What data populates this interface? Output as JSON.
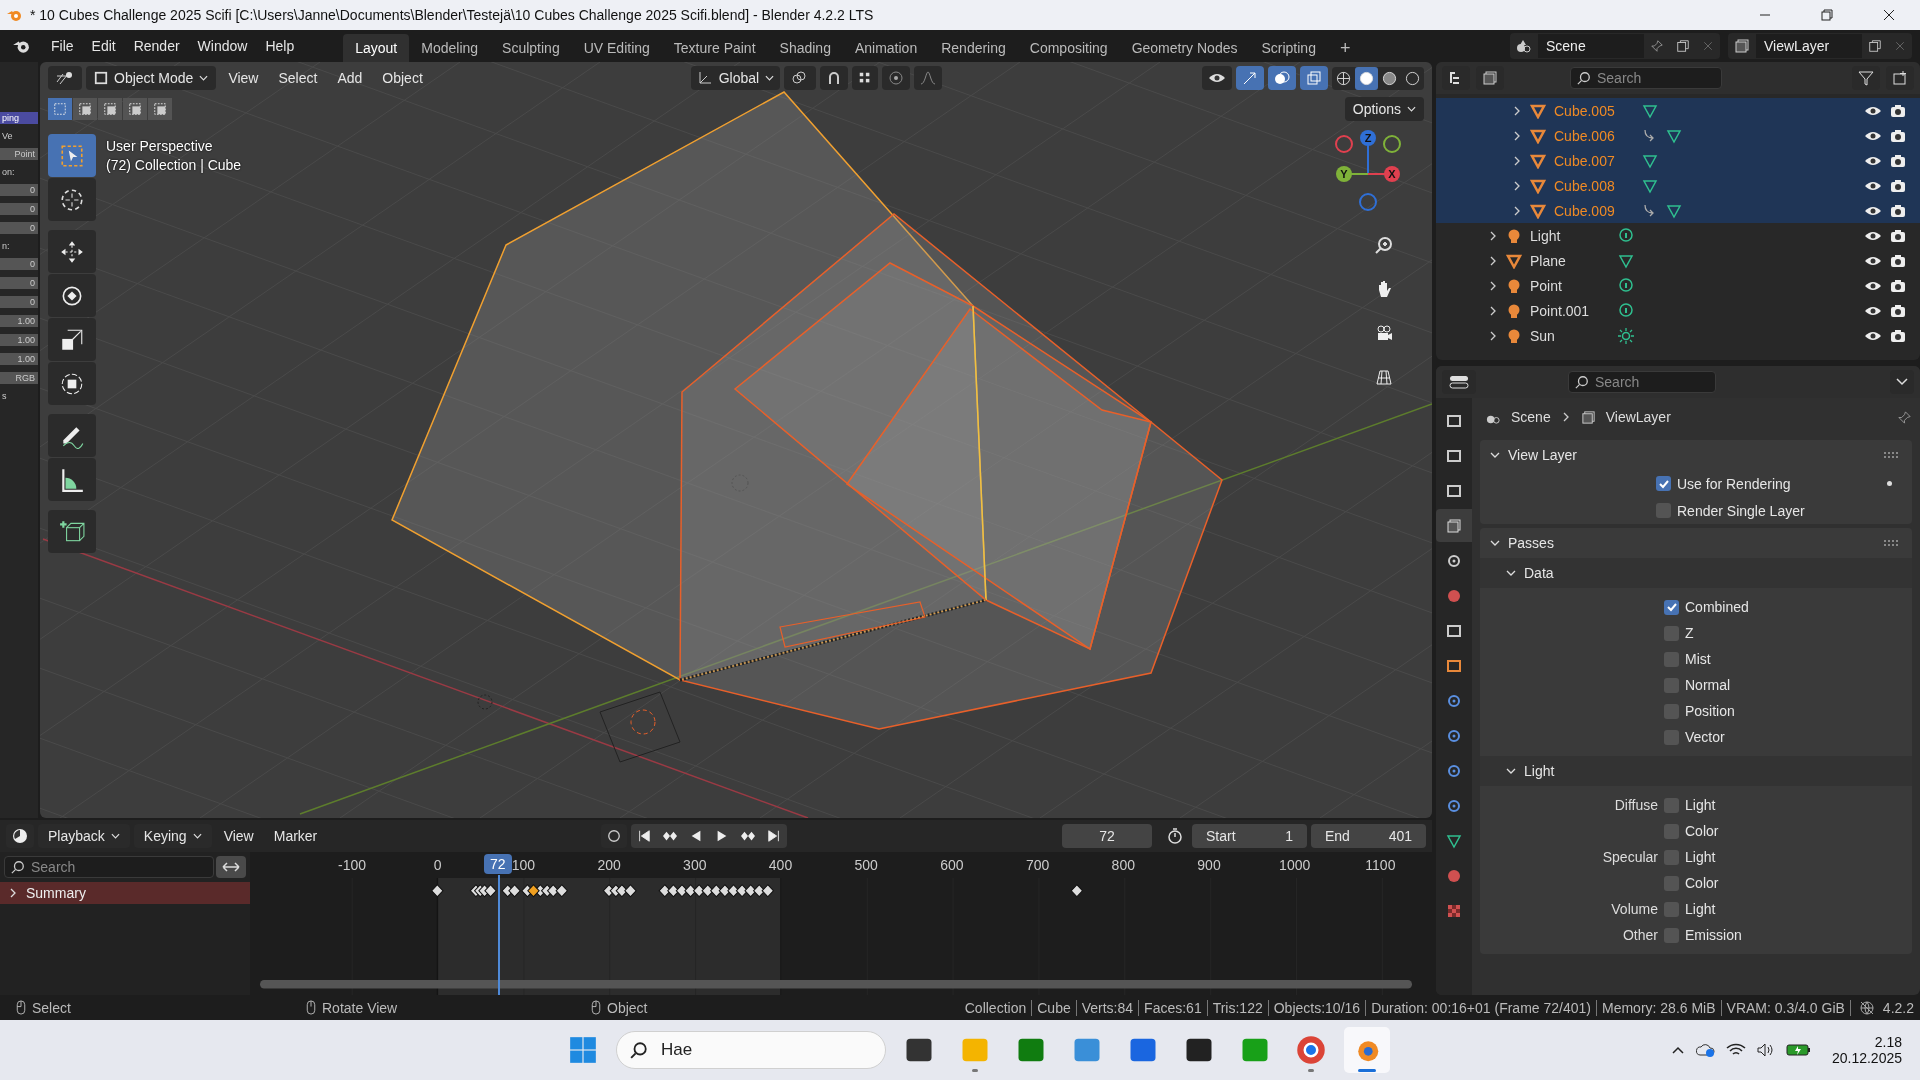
{
  "title_bar": {
    "title": "* 10 Cubes Challenge 2025 Scifi [C:\\Users\\Janne\\Documents\\Blender\\Testejä\\10 Cubes Challenge 2025 Scifi.blend] - Blender 4.2.2 LTS"
  },
  "menu": [
    "File",
    "Edit",
    "Render",
    "Window",
    "Help"
  ],
  "workspaces": [
    {
      "label": "Layout",
      "selected": true
    },
    {
      "label": "Modeling",
      "selected": false
    },
    {
      "label": "Sculpting",
      "selected": false
    },
    {
      "label": "UV Editing",
      "selected": false
    },
    {
      "label": "Texture Paint",
      "selected": false
    },
    {
      "label": "Shading",
      "selected": false
    },
    {
      "label": "Animation",
      "selected": false
    },
    {
      "label": "Rendering",
      "selected": false
    },
    {
      "label": "Compositing",
      "selected": false
    },
    {
      "label": "Geometry Nodes",
      "selected": false
    },
    {
      "label": "Scripting",
      "selected": false
    }
  ],
  "add_workspace": "+",
  "scene": {
    "name": "Scene"
  },
  "view_layer": {
    "name": "ViewLayer"
  },
  "left_panel": {
    "fragments": [
      {
        "kind": "header",
        "text": "ping"
      },
      {
        "kind": "label",
        "text": "Ve"
      },
      {
        "kind": "field",
        "text": "Point"
      },
      {
        "kind": "label",
        "text": "on:"
      },
      {
        "kind": "field",
        "text": "0"
      },
      {
        "kind": "field",
        "text": "0"
      },
      {
        "kind": "field",
        "text": "0"
      },
      {
        "kind": "label",
        "text": "n:"
      },
      {
        "kind": "field",
        "text": "0"
      },
      {
        "kind": "field",
        "text": "0"
      },
      {
        "kind": "field",
        "text": "0"
      },
      {
        "kind": "field",
        "text": "1.00"
      },
      {
        "kind": "field",
        "text": "1.00"
      },
      {
        "kind": "field",
        "text": "1.00"
      },
      {
        "kind": "field",
        "text": "RGB"
      },
      {
        "kind": "label",
        "text": "s"
      }
    ]
  },
  "viewport": {
    "mode": "Object Mode",
    "menus": [
      "View",
      "Select",
      "Add",
      "Object"
    ],
    "orientation": "Global",
    "options": "Options",
    "select_modes": [
      {
        "selected": true
      },
      {
        "selected": false
      },
      {
        "selected": false
      },
      {
        "selected": false
      },
      {
        "selected": false
      }
    ],
    "shading": [
      {
        "selected": false
      },
      {
        "selected": true
      },
      {
        "selected": false
      },
      {
        "selected": false
      }
    ],
    "tools": [
      {
        "selected": true
      },
      {
        "selected": false
      },
      {
        "selected": false
      },
      {
        "selected": false
      },
      {
        "selected": false
      },
      {
        "selected": false
      },
      {
        "selected": false
      },
      {
        "selected": false
      },
      {
        "selected": false
      }
    ],
    "overlay": [
      "User Perspective",
      "(72) Collection | Cube"
    ],
    "gizmo": [
      {
        "label": "Z",
        "color": "#2f6fd6"
      },
      {
        "label": "Y",
        "color": "#7fb239"
      },
      {
        "label": "X",
        "color": "#e0404f"
      }
    ]
  },
  "timeline": {
    "menus": [
      "Playback",
      "Keying",
      "View",
      "Marker"
    ],
    "current_frame": "72",
    "start_label": "Start",
    "start": "1",
    "end_label": "End",
    "end": "401",
    "search": {
      "placeholder": "Search"
    },
    "ruler": [
      "-100",
      "0",
      "100",
      "200",
      "300",
      "400",
      "500",
      "600",
      "700",
      "800",
      "900",
      "1000",
      "1100"
    ],
    "playhead": {
      "label": "72",
      "level": 0.212
    },
    "channels": [
      {
        "label": "Summary",
        "expanded": false
      }
    ]
  },
  "outliner": {
    "search": {
      "placeholder": "Search"
    },
    "nested_items": [
      {
        "name": "Cube.005",
        "selected": true,
        "modifier": false
      },
      {
        "name": "Cube.006",
        "selected": true,
        "modifier": true
      },
      {
        "name": "Cube.007",
        "selected": true,
        "modifier": false
      },
      {
        "name": "Cube.008",
        "selected": true,
        "modifier": false
      },
      {
        "name": "Cube.009",
        "selected": true,
        "modifier": true
      }
    ],
    "items": [
      {
        "name": "Light",
        "kind": "light",
        "selected": false
      },
      {
        "name": "Plane",
        "kind": "mesh",
        "selected": false
      },
      {
        "name": "Point",
        "kind": "light",
        "selected": false
      },
      {
        "name": "Point.001",
        "kind": "light",
        "selected": false
      },
      {
        "name": "Sun",
        "kind": "sun",
        "selected": false
      }
    ]
  },
  "properties": {
    "search": {
      "placeholder": "Search"
    },
    "tabs": [
      {
        "selected": false
      },
      {
        "selected": false
      },
      {
        "selected": false
      },
      {
        "selected": true
      },
      {
        "selected": false
      },
      {
        "selected": false
      },
      {
        "selected": false
      },
      {
        "selected": false
      },
      {
        "selected": false
      },
      {
        "selected": false
      },
      {
        "selected": false
      },
      {
        "selected": false
      },
      {
        "selected": false
      },
      {
        "selected": false
      },
      {
        "selected": false
      }
    ],
    "breadcrumb": [
      "Scene",
      "ViewLayer"
    ],
    "view_layer_panel": {
      "title": "View Layer",
      "expanded": true,
      "rows": [
        {
          "label": "Use for Rendering",
          "checked": true
        },
        {
          "label": "Render Single Layer",
          "checked": false
        }
      ]
    },
    "passes_panel": {
      "title": "Passes",
      "expanded": true,
      "subpanels": [
        {
          "title": "Data",
          "expanded": true,
          "rows": [
            {
              "label": "Combined",
              "checked": true
            },
            {
              "label": "Z",
              "checked": false
            },
            {
              "label": "Mist",
              "checked": false
            },
            {
              "label": "Normal",
              "checked": false
            },
            {
              "label": "Position",
              "checked": false
            },
            {
              "label": "Vector",
              "checked": false
            }
          ]
        },
        {
          "title": "Light",
          "expanded": true,
          "rows": [
            {
              "group": "Diffuse",
              "label": "Light",
              "checked": false
            },
            {
              "label": "Color",
              "checked": false
            },
            {
              "group": "Specular",
              "label": "Light",
              "checked": false
            },
            {
              "label": "Color",
              "checked": false
            },
            {
              "group": "Volume",
              "label": "Light",
              "checked": false
            },
            {
              "group": "Other",
              "label": "Emission",
              "checked": false
            }
          ]
        }
      ]
    }
  },
  "status_bar": {
    "hints": [
      "Select",
      "Rotate View",
      "Object"
    ],
    "stats": [
      "Collection",
      "Cube",
      "Verts:84",
      "Faces:61",
      "Tris:122",
      "Objects:10/16",
      "Duration: 00:16+01 (Frame 72/401)",
      "Memory: 28.6 MiB",
      "VRAM: 0.3/4.0 GiB"
    ],
    "version": "4.2.2"
  },
  "taskbar": {
    "search": {
      "value": "Hae"
    },
    "apps": [
      {
        "open": false,
        "active": false
      },
      {
        "open": true,
        "active": false
      },
      {
        "open": false,
        "active": false
      },
      {
        "open": false,
        "active": false
      },
      {
        "open": false,
        "active": false
      },
      {
        "open": false,
        "active": false
      },
      {
        "open": false,
        "active": false
      },
      {
        "open": true,
        "active": false
      },
      {
        "open": true,
        "active": true
      }
    ],
    "time": "2.18",
    "date": "20.12.2025"
  }
}
